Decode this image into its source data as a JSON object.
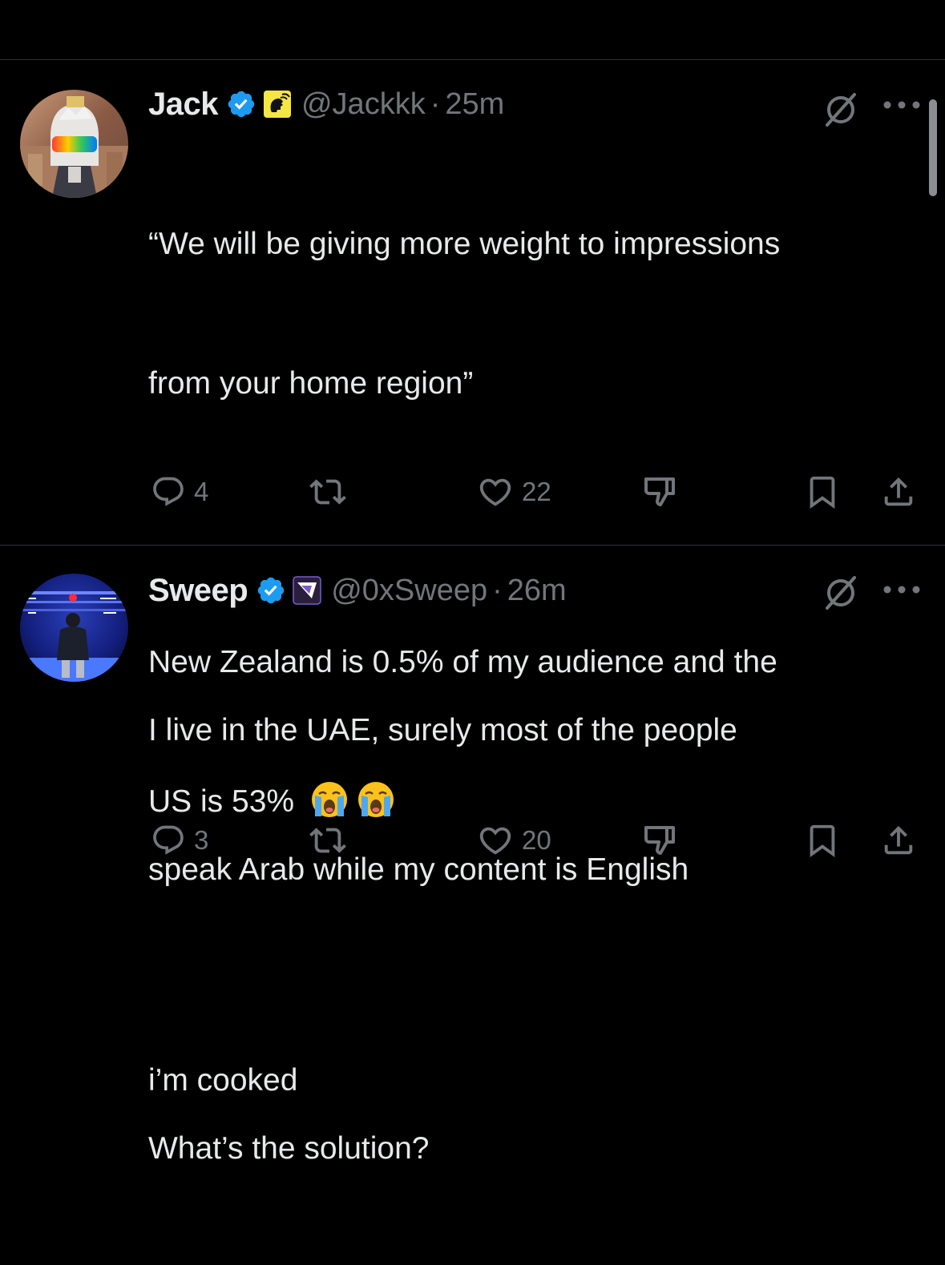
{
  "tweets": [
    {
      "name": "Jack",
      "handle": "@Jackkk",
      "separator": "·",
      "time": "25m",
      "text_lines": [
        "“We will be giving more weight to impressions",
        "from your home region”",
        "",
        "New Zealand is 0.5% of my audience and the",
        "US is 53% "
      ],
      "text_after": [
        "",
        "i’m cooked"
      ],
      "emojis": [
        "loudly-crying-face",
        "loudly-crying-face"
      ],
      "replies": "4",
      "reposts": "",
      "likes": "22"
    },
    {
      "name": "Sweep",
      "handle": "@0xSweep",
      "separator": "·",
      "time": "26m",
      "text_lines": [
        "I live in the UAE, surely most of the people",
        "speak Arab while my content is English",
        "",
        "What’s the solution?"
      ],
      "replies": "3",
      "reposts": "",
      "likes": "20"
    }
  ],
  "icons": {
    "verified": "verified-badge-icon",
    "grok": "grok-icon",
    "more": "more-icon",
    "reply": "reply-icon",
    "repost": "repost-icon",
    "like": "heart-icon",
    "dislike": "dislike-icon",
    "bookmark": "bookmark-icon",
    "share": "share-icon"
  },
  "colors": {
    "background": "#000000",
    "text": "#e7e9ea",
    "secondary": "#71767b",
    "verified": "#1d9bf0",
    "divider": "#2f3336"
  }
}
